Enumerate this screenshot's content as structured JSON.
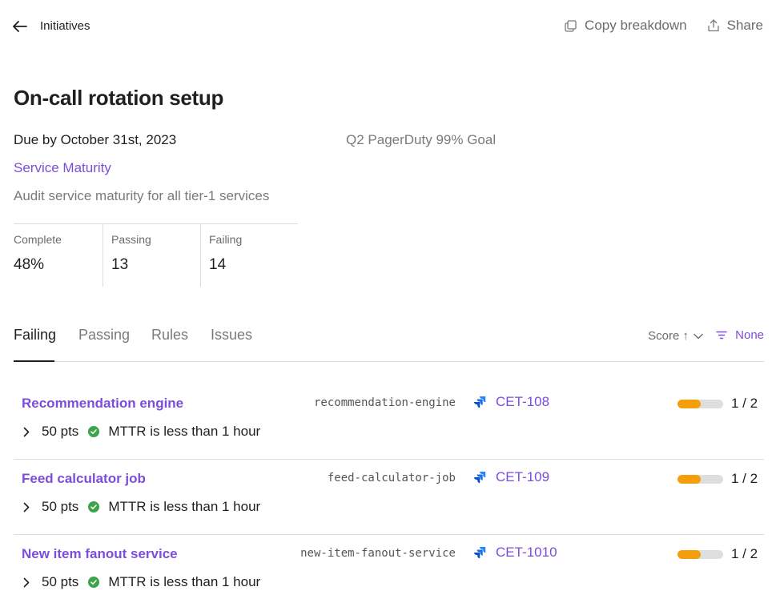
{
  "nav": {
    "back_label": "Initiatives"
  },
  "actions": {
    "copy_label": "Copy breakdown",
    "share_label": "Share"
  },
  "initiative": {
    "title": "On-call rotation setup",
    "due": "Due by October 31st, 2023",
    "goal": "Q2 PagerDuty 99% Goal",
    "scorecard": "Service Maturity",
    "description": "Audit service maturity for all tier-1 services"
  },
  "stats": [
    {
      "label": "Complete",
      "value": "48%"
    },
    {
      "label": "Passing",
      "value": "13"
    },
    {
      "label": "Failing",
      "value": "14"
    }
  ],
  "tabs": [
    {
      "label": "Failing",
      "active": true
    },
    {
      "label": "Passing",
      "active": false
    },
    {
      "label": "Rules",
      "active": false
    },
    {
      "label": "Issues",
      "active": false
    }
  ],
  "sort": {
    "label": "Score ↑"
  },
  "filter": {
    "label": "None"
  },
  "colors": {
    "accent": "#7c4ddb",
    "progress": "#f59e0b",
    "check": "#3fa34d",
    "jira": "#2684ff"
  },
  "services": [
    {
      "name": "Recommendation engine",
      "tag": "recommendation-engine",
      "issue": "CET-108",
      "progress": 0.5,
      "fraction": "1 / 2",
      "points": "50 pts",
      "rule": "MTTR is less than 1 hour"
    },
    {
      "name": "Feed calculator job",
      "tag": "feed-calculator-job",
      "issue": "CET-109",
      "progress": 0.5,
      "fraction": "1 / 2",
      "points": "50 pts",
      "rule": "MTTR is less than 1 hour"
    },
    {
      "name": "New item fanout service",
      "tag": "new-item-fanout-service",
      "issue": "CET-1010",
      "progress": 0.5,
      "fraction": "1 / 2",
      "points": "50 pts",
      "rule": "MTTR is less than 1 hour"
    }
  ]
}
